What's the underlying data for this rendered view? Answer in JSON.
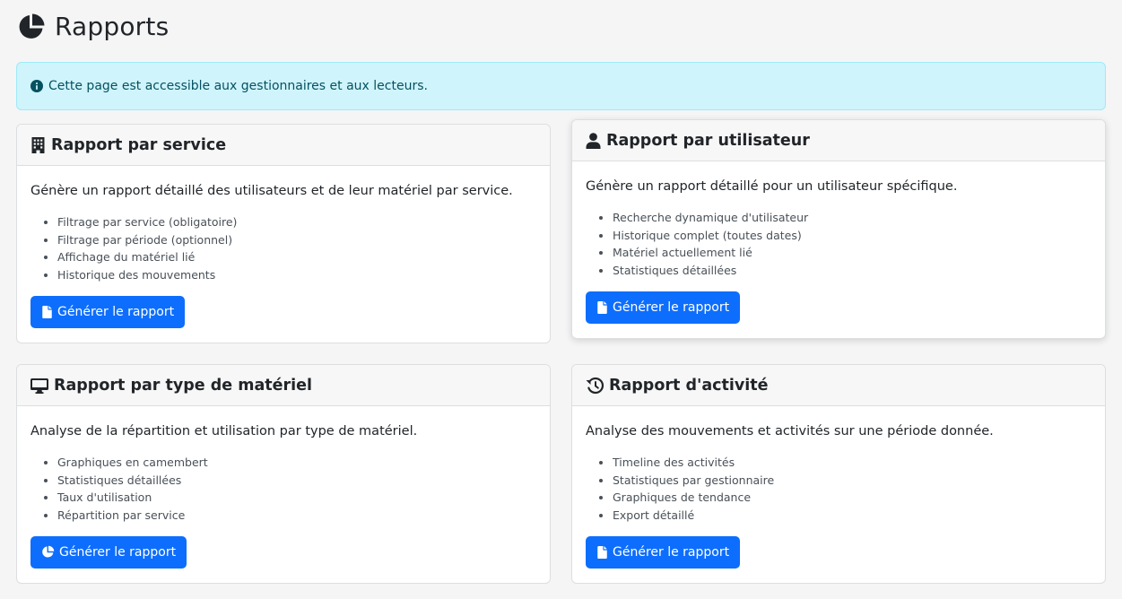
{
  "page": {
    "title": "Rapports",
    "icon": "chart-pie-icon"
  },
  "alert": {
    "icon": "info-circle-icon",
    "text": "Cette page est accessible aux gestionnaires et aux lecteurs.",
    "color": "#055160",
    "background": "#cff4fc"
  },
  "theme": {
    "accent": "#0d6efd"
  },
  "cards": [
    {
      "icon": "building-icon",
      "title": "Rapport par service",
      "description": "Génère un rapport détaillé des utilisateurs et de leur matériel par service.",
      "features": [
        "Filtrage par service (obligatoire)",
        "Filtrage par période (optionnel)",
        "Affichage du matériel lié",
        "Historique des mouvements"
      ],
      "button": {
        "icon": "file-icon",
        "label": "Générer le rapport"
      }
    },
    {
      "icon": "user-icon",
      "title": "Rapport par utilisateur",
      "description": "Génère un rapport détaillé pour un utilisateur spécifique.",
      "features": [
        "Recherche dynamique d'utilisateur",
        "Historique complet (toutes dates)",
        "Matériel actuellement lié",
        "Statistiques détaillées"
      ],
      "button": {
        "icon": "file-icon",
        "label": "Générer le rapport"
      }
    },
    {
      "icon": "desktop-icon",
      "title": "Rapport par type de matériel",
      "description": "Analyse de la répartition et utilisation par type de matériel.",
      "features": [
        "Graphiques en camembert",
        "Statistiques détaillées",
        "Taux d'utilisation",
        "Répartition par service"
      ],
      "button": {
        "icon": "chart-pie-icon",
        "label": "Générer le rapport"
      }
    },
    {
      "icon": "history-icon",
      "title": "Rapport d'activité",
      "description": "Analyse des mouvements et activités sur une période donnée.",
      "features": [
        "Timeline des activités",
        "Statistiques par gestionnaire",
        "Graphiques de tendance",
        "Export détaillé"
      ],
      "button": {
        "icon": "file-icon",
        "label": "Générer le rapport"
      }
    }
  ]
}
